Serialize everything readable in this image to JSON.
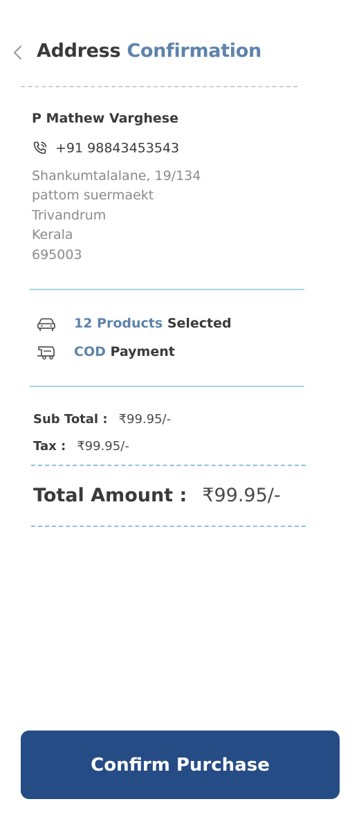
{
  "header": {
    "title_part1": "Address",
    "title_part2": "Confirmation",
    "back_icon": "chevron-left-icon"
  },
  "customer": {
    "name": "P Mathew Varghese",
    "phone_icon": "phone-call-icon",
    "phone": "+91 98843453543",
    "address_lines": [
      "Shankumtalalane, 19/134",
      "pattom suermaekt",
      "Trivandrum",
      "Kerala",
      "695003"
    ]
  },
  "order_info": {
    "products_count": "12 Products",
    "products_suffix": "Selected",
    "products_icon": "car-icon",
    "payment_method": "COD",
    "payment_suffix": "Payment",
    "payment_icon": "delivery-truck-icon"
  },
  "summary": {
    "subtotal_label": "Sub Total :",
    "subtotal_value": "₹99.95/-",
    "tax_label": "Tax :",
    "tax_value": "₹99.95/-",
    "total_label": "Total Amount :",
    "total_value": "₹99.95/-"
  },
  "actions": {
    "confirm_label": "Confirm Purchase"
  },
  "colors": {
    "accent": "#5e84ab",
    "button": "#264c85",
    "divider": "#a6d2e6"
  }
}
